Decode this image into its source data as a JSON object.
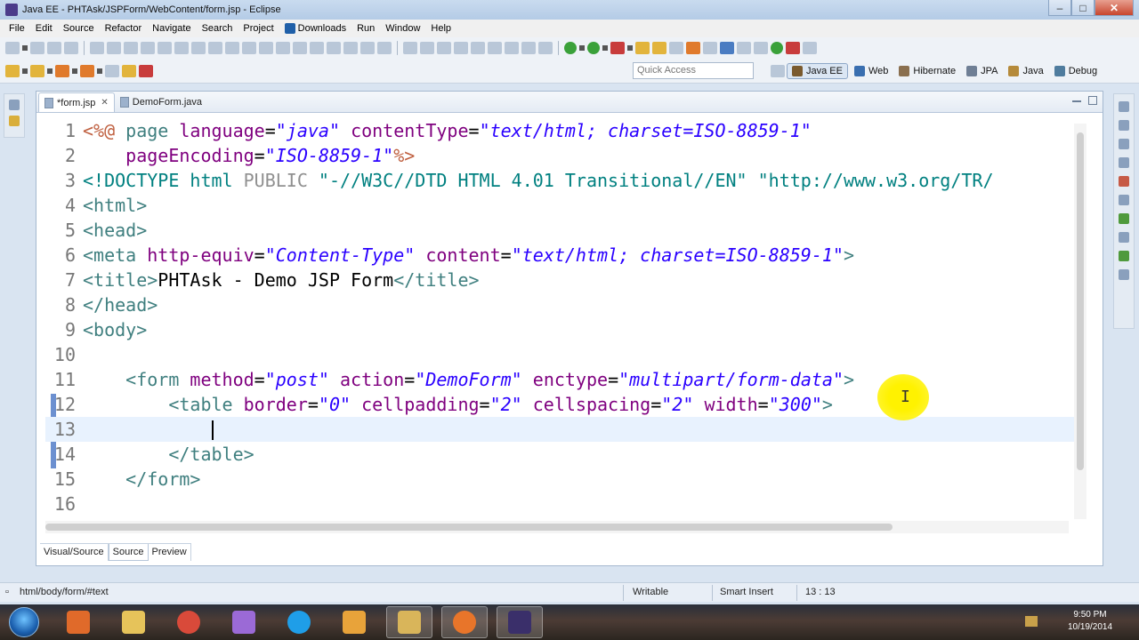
{
  "window": {
    "title": "Java EE - PHTAsk/JSPForm/WebContent/form.jsp - Eclipse",
    "minimize_label": "–",
    "maximize_label": "□",
    "close_label": "✕"
  },
  "menu": {
    "items": [
      {
        "label": "File"
      },
      {
        "label": "Edit"
      },
      {
        "label": "Source"
      },
      {
        "label": "Refactor"
      },
      {
        "label": "Navigate"
      },
      {
        "label": "Search"
      },
      {
        "label": "Project"
      },
      {
        "label": "Downloads"
      },
      {
        "label": "Run"
      },
      {
        "label": "Window"
      },
      {
        "label": "Help"
      }
    ]
  },
  "toolbar": {
    "quick_access_placeholder": "Quick Access",
    "perspectives": [
      {
        "label": "Java EE",
        "active": true,
        "color": "#7a5a2e"
      },
      {
        "label": "Web",
        "active": false,
        "color": "#3a6fb0"
      },
      {
        "label": "Hibernate",
        "active": false,
        "color": "#8a6f4f"
      },
      {
        "label": "JPA",
        "active": false,
        "color": "#6f7f95"
      },
      {
        "label": "Java",
        "active": false,
        "color": "#b58a3a"
      },
      {
        "label": "Debug",
        "active": false,
        "color": "#4f7c9e"
      }
    ]
  },
  "editor": {
    "tabs": [
      {
        "label": "*form.jsp",
        "active": true,
        "close": "✕"
      },
      {
        "label": "DemoForm.java",
        "active": false,
        "close": ""
      }
    ],
    "lines": [
      {
        "n": "1"
      },
      {
        "n": "2"
      },
      {
        "n": "3"
      },
      {
        "n": "4"
      },
      {
        "n": "5"
      },
      {
        "n": "6"
      },
      {
        "n": "7"
      },
      {
        "n": "8"
      },
      {
        "n": "9"
      },
      {
        "n": "10"
      },
      {
        "n": "11"
      },
      {
        "n": "12"
      },
      {
        "n": "13"
      },
      {
        "n": "14"
      },
      {
        "n": "15"
      },
      {
        "n": "16"
      }
    ],
    "code": {
      "l1_open": "<%@ ",
      "l1_page": "page ",
      "l1_language": "language",
      "l1_eq1": "=",
      "l1_language_val": "\"java\"",
      "l1_sp1": " ",
      "l1_contentType": "contentType",
      "l1_eq2": "=",
      "l1_contentType_val": "\"text/html; charset=ISO-8859-1\"",
      "l2_indent": "    ",
      "l2_pageEncoding": "pageEncoding",
      "l2_eq": "=",
      "l2_pageEncoding_val": "\"ISO-8859-1\"",
      "l2_close": "%>",
      "l3_doctype": "<!DOCTYPE html ",
      "l3_public": "PUBLIC ",
      "l3_id": "\"-//W3C//DTD HTML 4.01 Transitional//EN\" ",
      "l3_url": "\"http://www.w3.org/TR/",
      "l4": "<html>",
      "l5": "<head>",
      "l6_meta": "<meta ",
      "l6_httpequiv": "http-equiv",
      "l6_eq1": "=",
      "l6_httpequiv_val": "\"Content-Type\"",
      "l6_sp": " ",
      "l6_content": "content",
      "l6_eq2": "=",
      "l6_content_val": "\"text/html; charset=ISO-8859-1\"",
      "l6_close": ">",
      "l7_open": "<title>",
      "l7_text": "PHTAsk - Demo JSP Form",
      "l7_close": "</title>",
      "l8": "</head>",
      "l9": "<body>",
      "l11_indent": "    ",
      "l11_form": "<form ",
      "l11_method": "method",
      "l11_eq1": "=",
      "l11_method_val": "\"post\"",
      "l11_sp1": " ",
      "l11_action": "action",
      "l11_eq2": "=",
      "l11_action_val": "\"DemoForm\"",
      "l11_sp2": " ",
      "l11_enctype": "enctype",
      "l11_eq3": "=",
      "l11_enctype_val": "\"multipart/form-data\"",
      "l11_close": ">",
      "l12_indent": "        ",
      "l12_table": "<table ",
      "l12_border": "border",
      "l12_eq1": "=",
      "l12_border_val": "\"0\"",
      "l12_sp1": " ",
      "l12_cellpadding": "cellpadding",
      "l12_eq2": "=",
      "l12_cellpadding_val": "\"2\"",
      "l12_sp2": " ",
      "l12_cellspacing": "cellspacing",
      "l12_eq3": "=",
      "l12_cellspacing_val": "\"2\"",
      "l12_sp3": " ",
      "l12_width": "width",
      "l12_eq4": "=",
      "l12_width_val": "\"300\"",
      "l12_close": ">",
      "l13_indent": "            ",
      "l14_indent": "        ",
      "l14_close": "</table>",
      "l15_indent": "    ",
      "l15_close": "</form>"
    },
    "bottom_tabs": [
      {
        "label": "Visual/Source",
        "active": false
      },
      {
        "label": "Source",
        "active": true
      },
      {
        "label": "Preview",
        "active": false
      }
    ]
  },
  "status": {
    "path": "html/body/form/#text",
    "writable": "Writable",
    "insert_mode": "Smart Insert",
    "position": "13 : 13"
  },
  "taskbar": {
    "time": "9:50 PM",
    "date": "10/19/2014",
    "apps": [
      {
        "name": "media-player",
        "color": "#e06a2a"
      },
      {
        "name": "folder",
        "color": "#e6c35a"
      },
      {
        "name": "chrome",
        "color": "#d94a3a"
      },
      {
        "name": "app-purple",
        "color": "#9b6ad6"
      },
      {
        "name": "skype",
        "color": "#1f9ee8"
      },
      {
        "name": "outlook",
        "color": "#e8a33a"
      },
      {
        "name": "explorer",
        "color": "#d9b55a"
      },
      {
        "name": "firefox",
        "color": "#e8752a"
      },
      {
        "name": "eclipse",
        "color": "#3a2f6a"
      }
    ]
  }
}
